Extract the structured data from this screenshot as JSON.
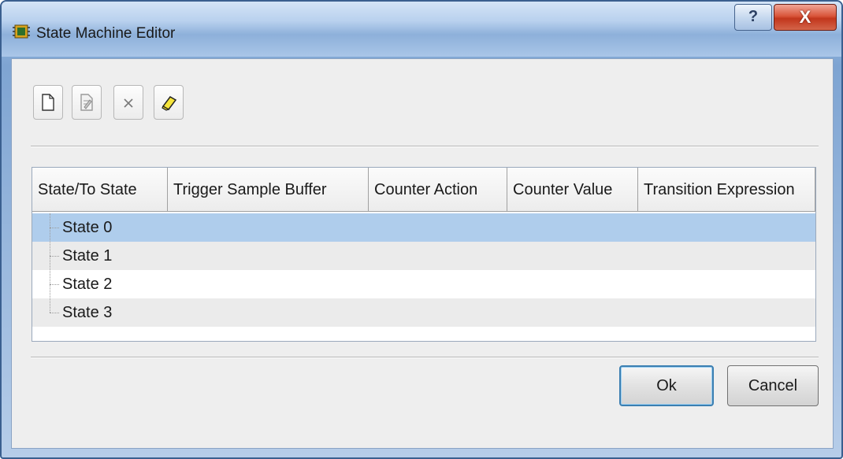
{
  "window": {
    "title": "State Machine Editor",
    "help_glyph": "?",
    "close_glyph": "X"
  },
  "toolbar": {
    "buttons": [
      {
        "icon": "new-document-icon"
      },
      {
        "icon": "edit-document-icon"
      },
      {
        "icon": "delete-icon"
      },
      {
        "icon": "eraser-icon"
      }
    ]
  },
  "table": {
    "columns": [
      "State/To State",
      "Trigger Sample Buffer",
      "Counter Action",
      "Counter Value",
      "Transition Expression"
    ],
    "rows": [
      {
        "label": "State 0",
        "selected": true
      },
      {
        "label": "State 1",
        "selected": false
      },
      {
        "label": "State 2",
        "selected": false
      },
      {
        "label": "State 3",
        "selected": false
      }
    ]
  },
  "footer": {
    "ok_label": "Ok",
    "cancel_label": "Cancel"
  },
  "colors": {
    "selected_row": "#afcdec",
    "alt_row": "#ebebeb",
    "default_button_border": "#3c7fb1",
    "close_button": "#c2361c"
  }
}
